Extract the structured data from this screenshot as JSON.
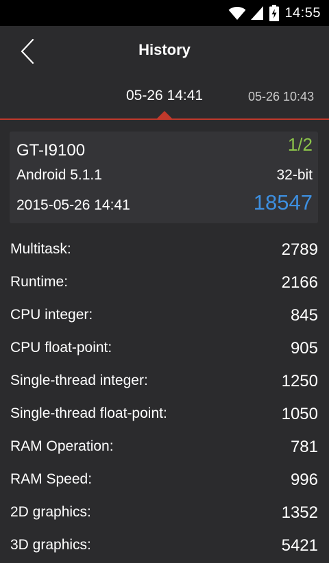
{
  "status_bar": {
    "time": "14:55",
    "icons": [
      "wifi-icon",
      "cellular-signal-icon",
      "battery-charging-icon"
    ]
  },
  "header": {
    "title": "History",
    "back_icon": "chevron-left-icon"
  },
  "tabs": [
    {
      "label": "05-26 14:41",
      "active": true
    },
    {
      "label": "05-26 10:43",
      "active": false
    }
  ],
  "summary": {
    "device": "GT-I9100",
    "page_indicator": "1/2",
    "os": "Android 5.1.1",
    "bitness": "32-bit",
    "datetime": "2015-05-26 14:41",
    "total_score": "18547"
  },
  "scores": [
    {
      "label": "Multitask:",
      "value": "2789"
    },
    {
      "label": "Runtime:",
      "value": "2166"
    },
    {
      "label": "CPU integer:",
      "value": "845"
    },
    {
      "label": "CPU float-point:",
      "value": "905"
    },
    {
      "label": "Single-thread integer:",
      "value": "1250"
    },
    {
      "label": "Single-thread float-point:",
      "value": "1050"
    },
    {
      "label": "RAM Operation:",
      "value": "781"
    },
    {
      "label": "RAM Speed:",
      "value": "996"
    },
    {
      "label": "2D graphics:",
      "value": "1352"
    },
    {
      "label": "3D graphics:",
      "value": "5421"
    }
  ],
  "colors": {
    "background": "#2b2b2d",
    "card": "#343437",
    "accent_red": "#c0392b",
    "page_indicator_green": "#8bc34a",
    "score_blue": "#3d8fe0"
  }
}
